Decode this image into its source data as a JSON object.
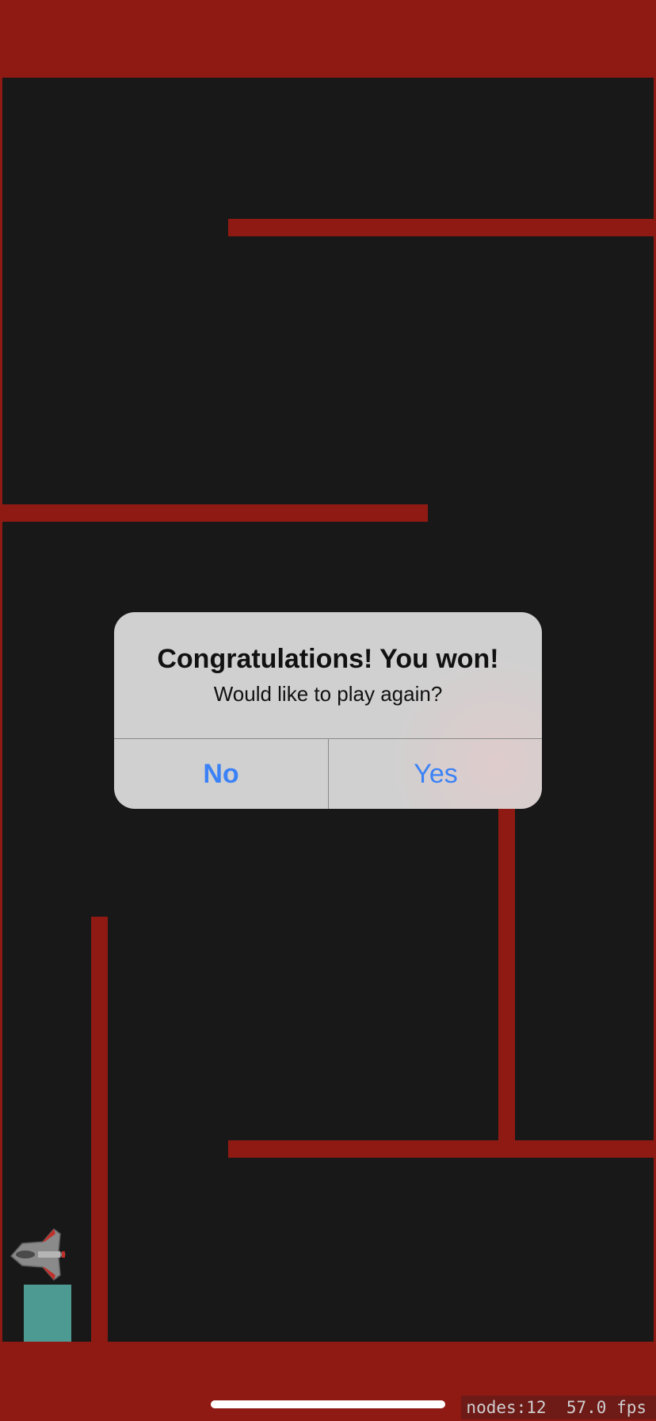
{
  "alert": {
    "title": "Congratulations! You won!",
    "message": "Would like to play again?",
    "no_label": "No",
    "yes_label": "Yes"
  },
  "debug": {
    "stats": "nodes:12  57.0 fps"
  },
  "colors": {
    "wall": "#8e1a13",
    "background": "#181818",
    "goal": "#4c9a91",
    "alert_button": "#3b82f6"
  }
}
